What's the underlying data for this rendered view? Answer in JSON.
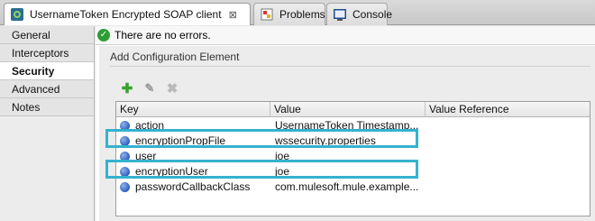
{
  "tabs": [
    {
      "label": "UsernameToken Encrypted SOAP client",
      "icon": "mule-flow-icon",
      "active": true
    },
    {
      "label": "Problems",
      "icon": "problems-icon"
    },
    {
      "label": "Console",
      "icon": "console-icon"
    }
  ],
  "tab_close_glyph": "⊠",
  "nav": {
    "items": [
      {
        "label": "General"
      },
      {
        "label": "Interceptors"
      },
      {
        "label": "Security",
        "selected": true
      },
      {
        "label": "Advanced"
      },
      {
        "label": "Notes"
      }
    ]
  },
  "status": {
    "text": "There are no errors.",
    "icon": "check-icon"
  },
  "section": {
    "title": "Add Configuration Element"
  },
  "toolbar": {
    "add_icon": "plus-icon",
    "edit_icon": "edit-icon",
    "delete_icon": "delete-icon"
  },
  "table": {
    "headers": {
      "key": "Key",
      "value": "Value",
      "reference": "Value Reference"
    },
    "rows": [
      {
        "key": "action",
        "value": "UsernameToken Timestamp..."
      },
      {
        "key": "encryptionPropFile",
        "value": "wssecurity.properties",
        "highlighted": true
      },
      {
        "key": "user",
        "value": "joe"
      },
      {
        "key": "encryptionUser",
        "value": "joe",
        "highlighted": true
      },
      {
        "key": "passwordCallbackClass",
        "value": "com.mulesoft.mule.example..."
      }
    ]
  },
  "colors": {
    "highlight": "#35b2cf",
    "add": "#3aa12e",
    "ok": "#2e9d34"
  }
}
